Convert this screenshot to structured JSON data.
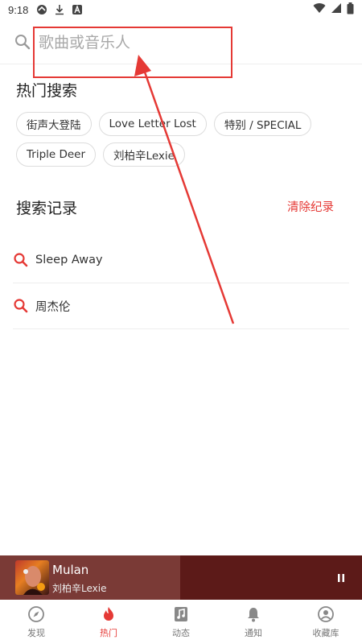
{
  "status_bar": {
    "time": "9:18",
    "left_icons": [
      "sync-icon",
      "download-icon",
      "notification-a-icon"
    ],
    "right_icons": [
      "wifi-icon",
      "signal-icon",
      "battery-icon"
    ]
  },
  "search": {
    "placeholder": "歌曲或音乐人"
  },
  "hot_search": {
    "title": "热门搜索",
    "tags": [
      "街声大登陆",
      "Love Letter Lost",
      "特别 / SPECIAL",
      "Triple Deer",
      "刘柏辛Lexie"
    ]
  },
  "history": {
    "title": "搜索记录",
    "clear_label": "清除纪录",
    "items": [
      "Sleep Away",
      "周杰伦"
    ]
  },
  "player": {
    "song_title": "Mulan",
    "artist": "刘柏辛Lexie",
    "state": "playing"
  },
  "tabs": [
    {
      "label": "发现",
      "icon": "compass-icon",
      "active": false
    },
    {
      "label": "热门",
      "icon": "flame-icon",
      "active": true
    },
    {
      "label": "动态",
      "icon": "music-note-icon",
      "active": false
    },
    {
      "label": "通知",
      "icon": "bell-icon",
      "active": false
    },
    {
      "label": "收藏库",
      "icon": "user-icon",
      "active": false
    }
  ],
  "colors": {
    "accent": "#e53935",
    "player_bg": "#5c1a18",
    "player_left": "#7a3a36"
  }
}
